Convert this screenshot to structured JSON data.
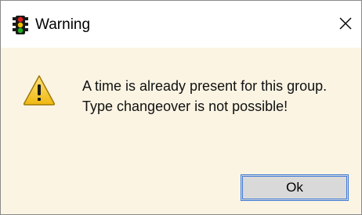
{
  "window": {
    "title": "Warning",
    "app_icon": "traffic-light-icon",
    "close_icon": "close-icon"
  },
  "message": {
    "icon": "warning-icon",
    "lines": [
      "A time is already present for this group.",
      "Type changeover is not possible!"
    ]
  },
  "buttons": {
    "ok_label": "Ok"
  },
  "colors": {
    "content_background": "#fbf4e3",
    "titlebar_background": "#ffffff",
    "button_border": "#3f7ad8",
    "button_face": "#d9d9d9",
    "warning_yellow": "#f3c623"
  }
}
